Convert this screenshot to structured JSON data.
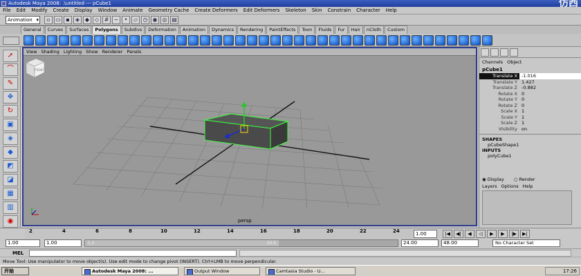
{
  "window": {
    "title": "Autodesk Maya 2008: .\\untitled   ---   pCube1",
    "watermark": "仿西"
  },
  "menubar": [
    "File",
    "Edit",
    "Modify",
    "Create",
    "Display",
    "Window",
    "Animate",
    "Geometry Cache",
    "Create Deformers",
    "Edit Deformers",
    "Skeleton",
    "Skin",
    "Constrain",
    "Character",
    "Help"
  ],
  "statusline": {
    "mode": "Animation"
  },
  "shelf": {
    "tabs": [
      "General",
      "Curves",
      "Surfaces",
      "Polygons",
      "Subdivs",
      "Deformation",
      "Animation",
      "Dynamics",
      "Rendering",
      "PaintEffects",
      "Toon",
      "Fluids",
      "Fur",
      "Hair",
      "nCloth",
      "Custom"
    ],
    "active_tab": "Polygons"
  },
  "panel": {
    "menu": [
      "View",
      "Shading",
      "Lighting",
      "Show",
      "Renderer",
      "Panels"
    ],
    "camera_label": "persp",
    "viewcube_label": "FRONT"
  },
  "channel_box": {
    "header": [
      "Channels",
      "Object"
    ],
    "object_name": "pCube1",
    "attributes": [
      {
        "name": "Translate X",
        "value": "-1.016"
      },
      {
        "name": "Translate Y",
        "value": "1.427"
      },
      {
        "name": "Translate Z",
        "value": "-0.882"
      },
      {
        "name": "Rotate X",
        "value": "0"
      },
      {
        "name": "Rotate Y",
        "value": "0"
      },
      {
        "name": "Rotate Z",
        "value": "0"
      },
      {
        "name": "Scale X",
        "value": "1"
      },
      {
        "name": "Scale Y",
        "value": "1"
      },
      {
        "name": "Scale Z",
        "value": "1"
      },
      {
        "name": "Visibility",
        "value": "on"
      }
    ],
    "shapes_header": "SHAPES",
    "shape_name": "pCubeShape1",
    "inputs_header": "INPUTS",
    "input_name": "polyCube1"
  },
  "layers": {
    "display_label": "Display",
    "render_label": "Render",
    "menu": [
      "Layers",
      "Options",
      "Help"
    ]
  },
  "timeslider": {
    "ticks": [
      "2",
      "4",
      "6",
      "8",
      "10",
      "12",
      "14",
      "16",
      "18",
      "20",
      "22",
      "24"
    ],
    "current_frame": "1.00"
  },
  "rangeslider": {
    "start": "1.00",
    "playback_start": "1.00",
    "playback_end": "24.00",
    "end": "48.00",
    "handle_start": "1.0",
    "handle_end": "24.0",
    "character_set": "No Character Set"
  },
  "cmdline": {
    "label": "MEL"
  },
  "helpline": {
    "text": "Move Tool: Use manipulator to move object(s). Use edit mode to change pivot (INSERT). Ctrl+LMB to move perpendicular."
  },
  "taskbar": {
    "start": "开始",
    "items": [
      "Autodesk Maya 2008: ...",
      "Output Window",
      "Camtasia Studio - U..."
    ],
    "clock": "17:26"
  }
}
